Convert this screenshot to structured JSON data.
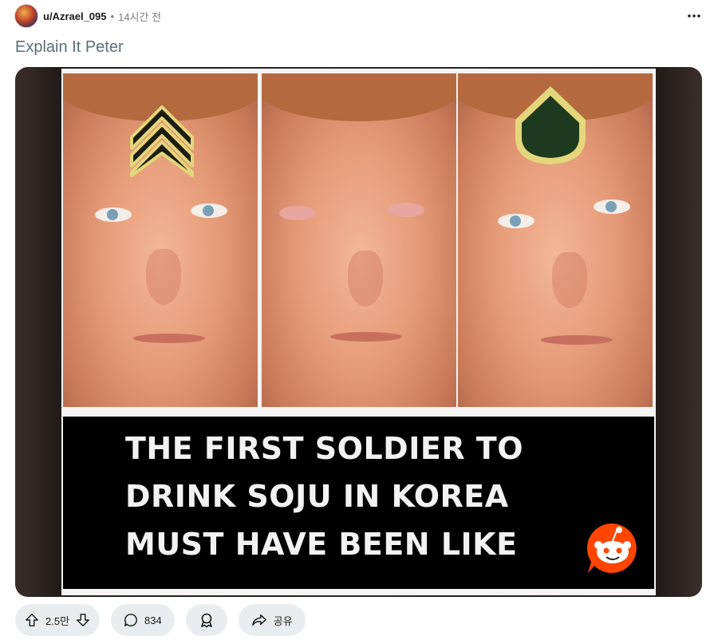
{
  "post": {
    "author": "u/Azrael_095",
    "separator": "•",
    "time": "14시간 전",
    "title": "Explain It Peter"
  },
  "meme": {
    "caption_lines": [
      "THE FIRST SOLDIER TO",
      "DRINK SOJU IN KOREA",
      "MUST HAVE BEEN LIKE"
    ]
  },
  "actions": {
    "votes": "2.5만",
    "comments": "834",
    "share_label": "공유"
  },
  "icons": {
    "more": "more-horizontal-icon",
    "upvote": "arrow-up-icon",
    "downvote": "arrow-down-icon",
    "comment": "comment-bubble-icon",
    "award": "award-icon",
    "share": "share-arrow-icon"
  },
  "colors": {
    "title": "#576f76",
    "pill_bg": "#eaedef",
    "reddit_orange": "#ff4500"
  }
}
